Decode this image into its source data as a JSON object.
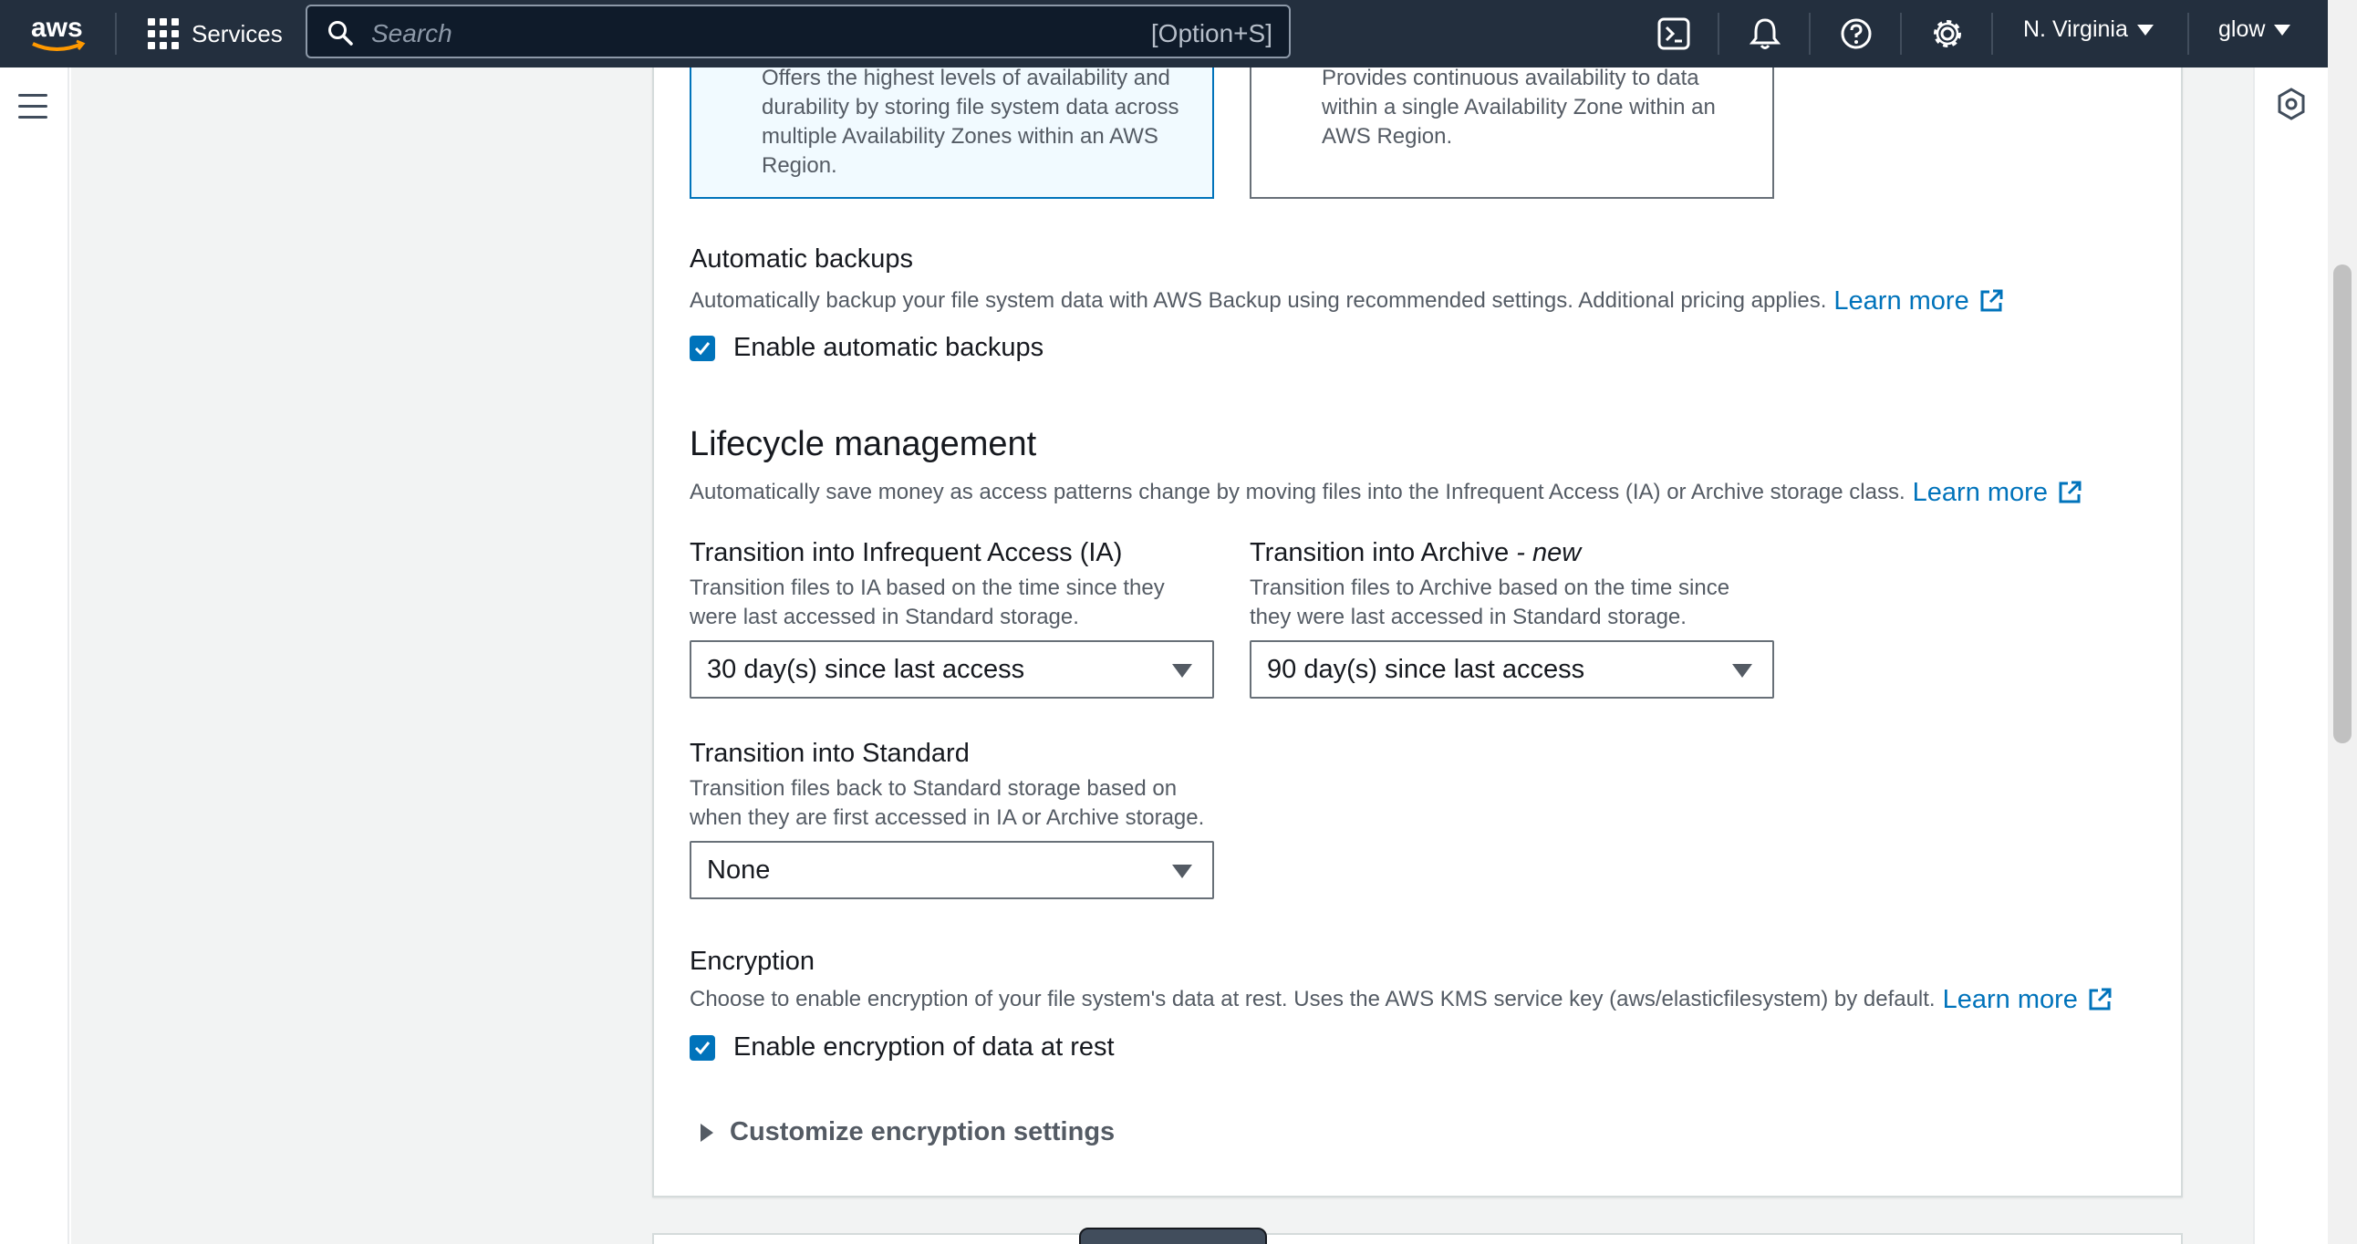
{
  "topnav": {
    "logo_text": "aws",
    "services_label": "Services",
    "search_placeholder": "Search",
    "search_shortcut": "[Option+S]",
    "region": "N. Virginia",
    "user": "glow"
  },
  "availability_tiles": [
    {
      "description": "Offers the highest levels of availability and durability by storing file system data across multiple Availability Zones within an AWS Region.",
      "selected": true
    },
    {
      "description": "Provides continuous availability to data within a single Availability Zone within an AWS Region.",
      "selected": false
    }
  ],
  "automatic_backups": {
    "title": "Automatic backups",
    "description": "Automatically backup your file system data with AWS Backup using recommended settings. Additional pricing applies.",
    "learn_more": "Learn more",
    "checkbox_label": "Enable automatic backups",
    "checked": true
  },
  "lifecycle": {
    "heading": "Lifecycle management",
    "description": "Automatically save money as access patterns change by moving files into the Infrequent Access (IA) or Archive storage class.",
    "learn_more": "Learn more",
    "ia": {
      "label": "Transition into Infrequent Access (IA)",
      "description_line1": "Transition files to IA based on the time since they",
      "description_line2": "were last accessed in Standard storage.",
      "value": "30 day(s) since last access"
    },
    "archive": {
      "label": "Transition into Archive",
      "label_suffix": "- new",
      "description_line1": "Transition files to Archive based on the time since",
      "description_line2": "they were last accessed in Standard storage.",
      "value": "90 day(s) since last access"
    },
    "standard": {
      "label": "Transition into Standard",
      "description_line1": "Transition files back to Standard storage based on",
      "description_line2": "when they are first accessed in IA or Archive storage.",
      "value": "None"
    }
  },
  "encryption": {
    "title": "Encryption",
    "description": "Choose to enable encryption of your file system's data at rest. Uses the AWS KMS service key (aws/elasticfilesystem) by default.",
    "learn_more": "Learn more",
    "checkbox_label": "Enable encryption of data at rest",
    "checked": true,
    "customize_label": "Customize encryption settings"
  },
  "colors": {
    "nav_bg": "#232f3e",
    "link": "#0073bb",
    "selected_tile_bg": "#f1faff"
  }
}
